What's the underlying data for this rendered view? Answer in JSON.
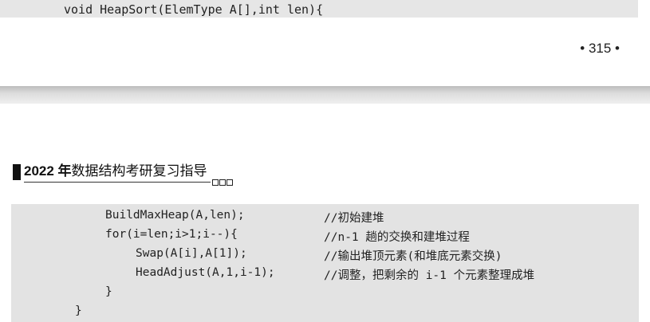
{
  "top_page": {
    "code_line": "void HeapSort(ElemType A[],int len){",
    "page_number": "• 315 •"
  },
  "header": {
    "title_bold": "2022 年",
    "title_rest": "数据结构考研复习指导"
  },
  "code_lines": [
    {
      "code": "BuildMaxHeap(A,len);",
      "comment": "//初始建堆"
    },
    {
      "code": "for(i=len;i>1;i--){",
      "comment": "//n-1 趟的交换和建堆过程"
    },
    {
      "code": "Swap(A[i],A[1]);",
      "comment": "//输出堆顶元素(和堆底元素交换)"
    },
    {
      "code": "HeadAdjust(A,1,i-1);",
      "comment": "//调整，把剩余的 i-1 个元素整理成堆"
    },
    {
      "code": "}",
      "comment": ""
    },
    {
      "code": "}",
      "comment": ""
    }
  ]
}
